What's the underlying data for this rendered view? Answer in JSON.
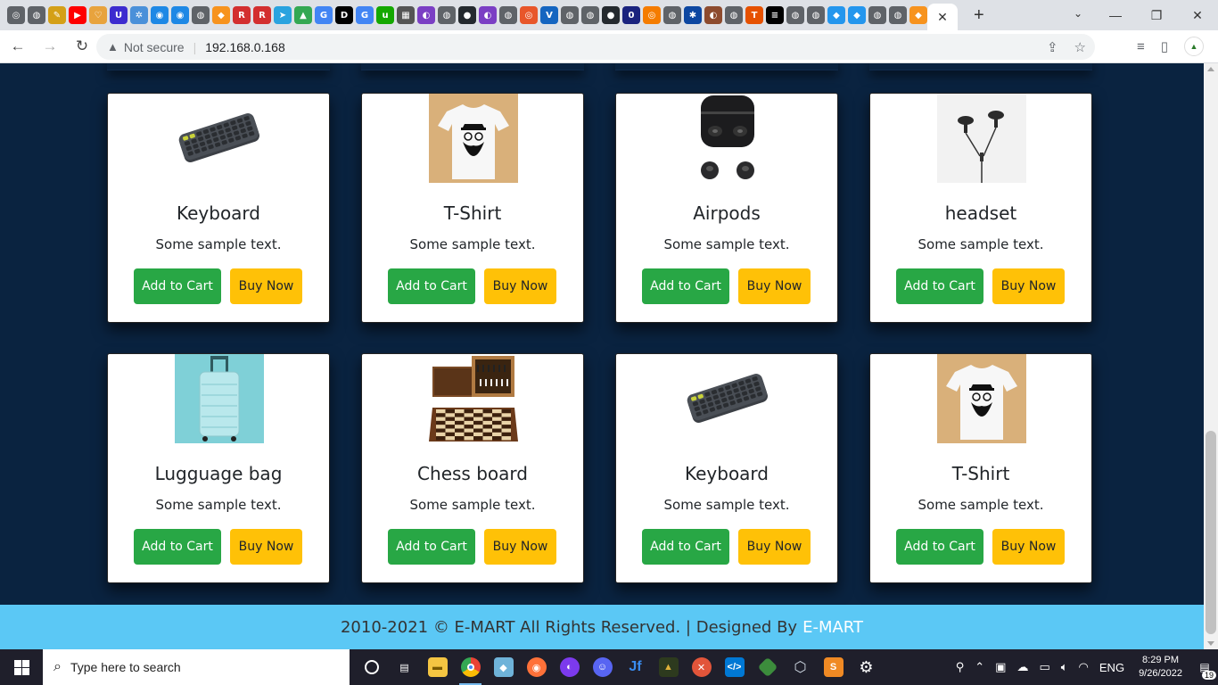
{
  "browser": {
    "tab_icons": [
      {
        "name": "tab-favicon",
        "color": "#5f6368",
        "glyph": "◎"
      },
      {
        "name": "tab-favicon",
        "color": "#5f6368",
        "glyph": "◍"
      },
      {
        "name": "tab-favicon",
        "color": "#d4a017",
        "glyph": "✎"
      },
      {
        "name": "tab-favicon-youtube",
        "color": "#ff0000",
        "glyph": "▶"
      },
      {
        "name": "tab-favicon",
        "color": "#e8a33d",
        "glyph": "♡"
      },
      {
        "name": "tab-favicon",
        "color": "#3d2ccf",
        "glyph": "U"
      },
      {
        "name": "tab-favicon",
        "color": "#4a90d9",
        "glyph": "✲"
      },
      {
        "name": "tab-favicon",
        "color": "#1e88e5",
        "glyph": "◉"
      },
      {
        "name": "tab-favicon",
        "color": "#1e88e5",
        "glyph": "◉"
      },
      {
        "name": "tab-favicon",
        "color": "#5f6368",
        "glyph": "◍"
      },
      {
        "name": "tab-favicon",
        "color": "#f7931e",
        "glyph": "◆"
      },
      {
        "name": "tab-favicon",
        "color": "#d32f2f",
        "glyph": "R"
      },
      {
        "name": "tab-favicon",
        "color": "#d32f2f",
        "glyph": "R"
      },
      {
        "name": "tab-favicon-telegram",
        "color": "#2aa3df",
        "glyph": "➤"
      },
      {
        "name": "tab-favicon-drive",
        "color": "#34a853",
        "glyph": "▲"
      },
      {
        "name": "tab-favicon-google",
        "color": "#4285f4",
        "glyph": "G"
      },
      {
        "name": "tab-favicon",
        "color": "#000000",
        "glyph": "D"
      },
      {
        "name": "tab-favicon-google",
        "color": "#4285f4",
        "glyph": "G"
      },
      {
        "name": "tab-favicon",
        "color": "#14a800",
        "glyph": "u"
      },
      {
        "name": "tab-favicon",
        "color": "#555555",
        "glyph": "▦"
      },
      {
        "name": "tab-favicon",
        "color": "#7b3fc4",
        "glyph": "◐"
      },
      {
        "name": "tab-favicon",
        "color": "#5f6368",
        "glyph": "◍"
      },
      {
        "name": "tab-favicon-github",
        "color": "#24292e",
        "glyph": "●"
      },
      {
        "name": "tab-favicon",
        "color": "#7b3fc4",
        "glyph": "◐"
      },
      {
        "name": "tab-favicon",
        "color": "#5f6368",
        "glyph": "◍"
      },
      {
        "name": "tab-favicon",
        "color": "#e8562a",
        "glyph": "◎"
      },
      {
        "name": "tab-favicon",
        "color": "#1565c0",
        "glyph": "V"
      },
      {
        "name": "tab-favicon",
        "color": "#5f6368",
        "glyph": "◍"
      },
      {
        "name": "tab-favicon",
        "color": "#5f6368",
        "glyph": "◍"
      },
      {
        "name": "tab-favicon-github",
        "color": "#24292e",
        "glyph": "●"
      },
      {
        "name": "tab-favicon",
        "color": "#1a237e",
        "glyph": "0"
      },
      {
        "name": "tab-favicon",
        "color": "#f57c00",
        "glyph": "◎"
      },
      {
        "name": "tab-favicon",
        "color": "#5f6368",
        "glyph": "◍"
      },
      {
        "name": "tab-favicon",
        "color": "#0d47a1",
        "glyph": "✱"
      },
      {
        "name": "tab-favicon",
        "color": "#8d4b2e",
        "glyph": "◐"
      },
      {
        "name": "tab-favicon",
        "color": "#5f6368",
        "glyph": "◍"
      },
      {
        "name": "tab-favicon",
        "color": "#e65100",
        "glyph": "T"
      },
      {
        "name": "tab-favicon",
        "color": "#000000",
        "glyph": "≡"
      },
      {
        "name": "tab-favicon",
        "color": "#5f6368",
        "glyph": "◍"
      },
      {
        "name": "tab-favicon",
        "color": "#5f6368",
        "glyph": "◍"
      },
      {
        "name": "tab-favicon",
        "color": "#2496ed",
        "glyph": "◆"
      },
      {
        "name": "tab-favicon",
        "color": "#2496ed",
        "glyph": "◆"
      },
      {
        "name": "tab-favicon",
        "color": "#5f6368",
        "glyph": "◍"
      },
      {
        "name": "tab-favicon",
        "color": "#5f6368",
        "glyph": "◍"
      },
      {
        "name": "tab-favicon",
        "color": "#f7931e",
        "glyph": "◆"
      }
    ],
    "active_tab_close": "✕",
    "new_tab": "+",
    "window_controls": {
      "search": "⌄",
      "minimize": "—",
      "restore": "❐",
      "close": "✕"
    },
    "security_label": "Not secure",
    "url": "192.168.0.168"
  },
  "products": [
    {
      "title": "Keyboard",
      "text": "Some sample text.",
      "image": "keyboard"
    },
    {
      "title": "T-Shirt",
      "text": "Some sample text.",
      "image": "tshirt"
    },
    {
      "title": "Airpods",
      "text": "Some sample text.",
      "image": "airpods"
    },
    {
      "title": "headset",
      "text": "Some sample text.",
      "image": "headset"
    },
    {
      "title": "Lugguage bag",
      "text": "Some sample text.",
      "image": "luggage"
    },
    {
      "title": "Chess board",
      "text": "Some sample text.",
      "image": "chess"
    },
    {
      "title": "Keyboard",
      "text": "Some sample text.",
      "image": "keyboard"
    },
    {
      "title": "T-Shirt",
      "text": "Some sample text.",
      "image": "tshirt"
    }
  ],
  "buttons": {
    "cart": "Add to Cart",
    "buy": "Buy Now"
  },
  "footer": {
    "text": "2010-2021 © E-MART All Rights Reserved. | Designed By",
    "brand": "E-MART"
  },
  "colors": {
    "page_bg": "#0a2340",
    "cart_btn": "#28a745",
    "buy_btn": "#ffc107",
    "footer_bg": "#5bc8f5"
  },
  "taskbar": {
    "search_placeholder": "Type here to search",
    "time": "8:29 PM",
    "date": "9/26/2022",
    "lang": "ENG",
    "notification_count": "19"
  }
}
